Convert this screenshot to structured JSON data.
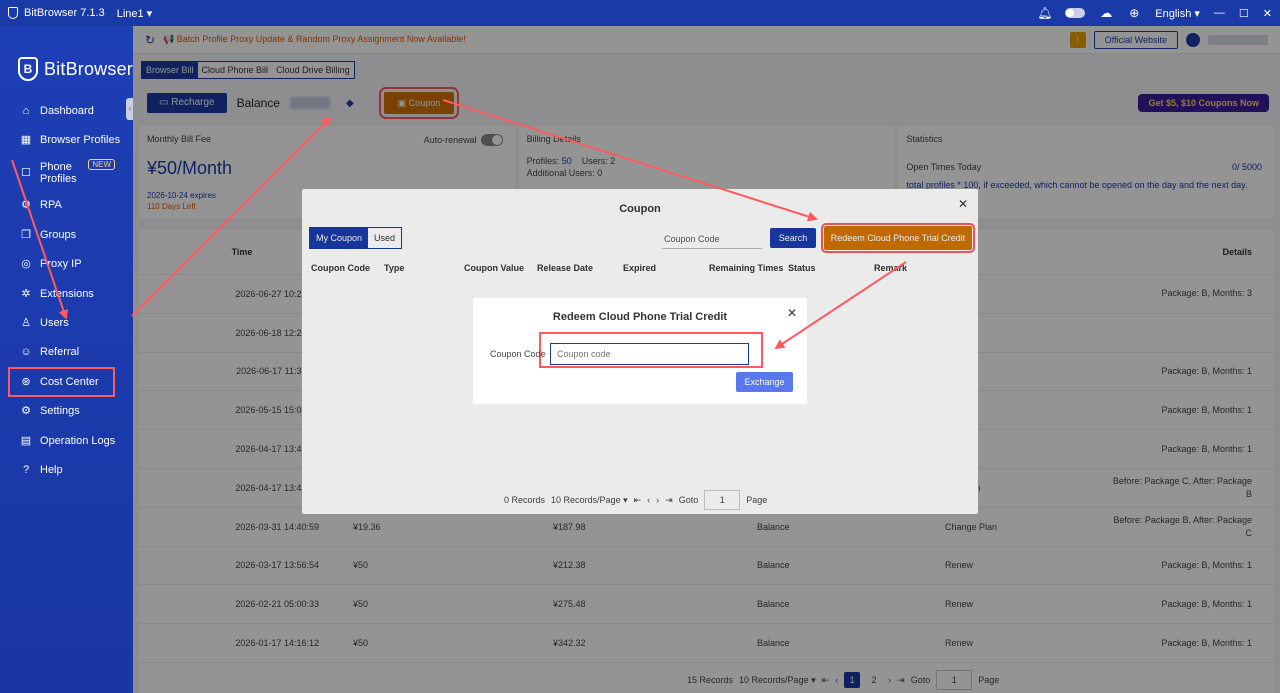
{
  "titlebar": {
    "app_title": "BitBrowser 7.1.3",
    "line": "Line1 ▾",
    "language": "English ▾",
    "minimize": "—",
    "maximize": "☐",
    "close": "✕"
  },
  "sidebar": {
    "brand": "BitBrowser",
    "items": [
      {
        "label": "Dashboard",
        "icon": "⌂"
      },
      {
        "label": "Browser Profiles",
        "icon": "▦"
      },
      {
        "label": "Phone Profiles",
        "icon": "☐",
        "badge": "NEW"
      },
      {
        "label": "RPA",
        "icon": "⚙"
      },
      {
        "label": "Groups",
        "icon": "❒"
      },
      {
        "label": "Proxy IP",
        "icon": "◎"
      },
      {
        "label": "Extensions",
        "icon": "✲"
      },
      {
        "label": "Users",
        "icon": "♙"
      },
      {
        "label": "Referral",
        "icon": "☺"
      },
      {
        "label": "Cost Center",
        "icon": "⊛"
      },
      {
        "label": "Settings",
        "icon": "⚙"
      },
      {
        "label": "Operation Logs",
        "icon": "▤"
      },
      {
        "label": "Help",
        "icon": "?"
      }
    ]
  },
  "notice": {
    "text": "📢 Batch Profile Proxy Update & Random Proxy Assignment Now Available!",
    "notif_icon": "!",
    "official_website": "Official Website"
  },
  "billing_tabs": [
    "Browser Bill",
    "Cloud Phone Bill",
    "Cloud Drive Billing"
  ],
  "actions": {
    "recharge": "Recharge",
    "balance_label": "Balance",
    "coupon": "Coupon",
    "promo": "Get $5, $10 Coupons Now"
  },
  "cards": {
    "monthly_fee_title": "Monthly Bill Fee",
    "auto_renewal": "Auto-renewal",
    "fee": "¥50/Month",
    "expires": "2026-10-24 expires",
    "days_left": "110 Days Left",
    "billing_title": "Billing Details",
    "profiles_label": "Profiles:",
    "profiles_value": "50",
    "users_label": "Users: 2",
    "additional_users": "Additional Users: 0",
    "stats_title": "Statistics",
    "open_times_label": "Open Times Today",
    "open_times_value": "0/ 5000",
    "stats_note": "total profiles * 100, if exceeded, which cannot be opened on the day and the next day."
  },
  "bill_table": {
    "headers": {
      "time": "Time",
      "order_type": "er Type",
      "details": "Details"
    },
    "rows": [
      {
        "time": "2026-06-27 10:28:48",
        "amount": "",
        "balance": "",
        "pay": "",
        "type": "ew",
        "details": "Package: B, Months: 3"
      },
      {
        "time": "2026-06-18 12:22:17",
        "amount": "",
        "balance": "",
        "pay": "",
        "type": "harge",
        "details": ""
      },
      {
        "time": "2026-06-17 11:31:29",
        "amount": "",
        "balance": "",
        "pay": "",
        "type": "ew",
        "details": "Package: B, Months: 1"
      },
      {
        "time": "2026-05-15 15:03:26",
        "amount": "",
        "balance": "",
        "pay": "",
        "type": "ew",
        "details": "Package: B, Months: 1"
      },
      {
        "time": "2026-04-17 13:42:32",
        "amount": "",
        "balance": "",
        "pay": "",
        "type": "ew",
        "details": "Package: B, Months: 1"
      },
      {
        "time": "2026-04-17 13:42:13",
        "amount": "",
        "balance": "",
        "pay": "",
        "type": "nge Plan",
        "details": "Before: Package C, After: Package B"
      },
      {
        "time": "2026-03-31 14:40:59",
        "amount": "¥19.36",
        "balance": "¥187.98",
        "pay": "Balance",
        "type": "Change Plan",
        "details": "Before: Package B, After: Package C"
      },
      {
        "time": "2026-03-17 13:56:54",
        "amount": "¥50",
        "balance": "¥212.38",
        "pay": "Balance",
        "type": "Renew",
        "details": "Package: B, Months: 1"
      },
      {
        "time": "2026-02-21 05:00:33",
        "amount": "¥50",
        "balance": "¥275.48",
        "pay": "Balance",
        "type": "Renew",
        "details": "Package: B, Months: 1"
      },
      {
        "time": "2026-01-17 14:16:12",
        "amount": "¥50",
        "balance": "¥342.32",
        "pay": "Balance",
        "type": "Renew",
        "details": "Package: B, Months: 1"
      }
    ],
    "pager": {
      "records": "15 Records",
      "per_page": "10 Records/Page ▾",
      "pages": [
        "1",
        "2"
      ],
      "goto": "Goto",
      "goto_value": "1",
      "page": "Page"
    }
  },
  "coupon_modal": {
    "title": "Coupon",
    "tabs": [
      "My Coupon",
      "Used"
    ],
    "search_placeholder": "Coupon Code",
    "search_button": "Search",
    "redeem_button": "Redeem Cloud Phone Trial Credit",
    "columns": [
      "Coupon Code",
      "Type",
      "Coupon Value",
      "Release Date",
      "Expired",
      "Remaining Times",
      "Status",
      "Remark"
    ],
    "pager": {
      "records": "0 Records",
      "per_page": "10 Records/Page ▾",
      "goto": "Goto",
      "goto_value": "1",
      "page": "Page"
    }
  },
  "redeem_dialog": {
    "title": "Redeem Cloud Phone Trial Credit",
    "label": "Coupon Code",
    "placeholder": "Coupon code",
    "button": "Exchange"
  },
  "colors": {
    "brand_blue": "#1a3aa8",
    "coupon_orange": "#d07200",
    "highlight_red": "#ff5a5f"
  }
}
